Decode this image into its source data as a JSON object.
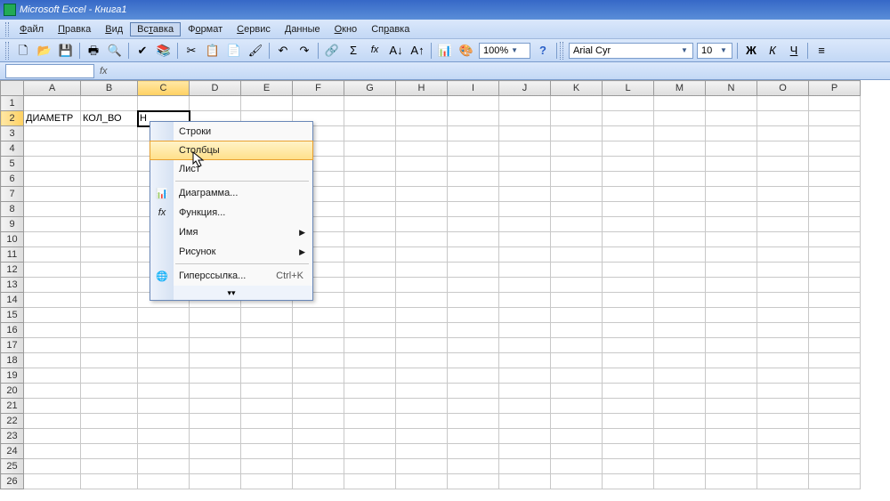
{
  "title": "Microsoft Excel - Книга1",
  "menubar": [
    "Файл",
    "Правка",
    "Вид",
    "Вставка",
    "Формат",
    "Сервис",
    "Данные",
    "Окно",
    "Справка"
  ],
  "menubar_underline_idx": [
    0,
    0,
    0,
    2,
    1,
    0,
    0,
    0,
    2
  ],
  "menu_open_index": 3,
  "dropdown": {
    "items": [
      {
        "label": "Строки",
        "icon": "",
        "submenu": false
      },
      {
        "label": "Столбцы",
        "icon": "",
        "submenu": false,
        "highlight": true
      },
      {
        "label": "Лист",
        "icon": "",
        "submenu": false,
        "sep_after": true
      },
      {
        "label": "Диаграмма...",
        "icon": "📊",
        "submenu": false
      },
      {
        "label": "Функция...",
        "icon": "fx",
        "submenu": false
      },
      {
        "label": "Имя",
        "icon": "",
        "submenu": true
      },
      {
        "label": "Рисунок",
        "icon": "",
        "submenu": true,
        "sep_after": true
      },
      {
        "label": "Гиперссылка...",
        "icon": "🌐",
        "shortcut": "Ctrl+K",
        "submenu": false
      }
    ]
  },
  "toolbar": {
    "zoom": "100%",
    "font": "Arial Cyr",
    "fontsize": "10"
  },
  "grid": {
    "columns": [
      "A",
      "B",
      "C",
      "D",
      "E",
      "F",
      "G",
      "H",
      "I",
      "J",
      "K",
      "L",
      "M",
      "N",
      "O",
      "P"
    ],
    "rows": 26,
    "active_cell": "C2",
    "selected_col": 2,
    "selected_row": 2,
    "cells": {
      "A2": "ДИАМЕТР",
      "B2": "КОЛ_ВО",
      "C2": "Н"
    }
  },
  "formulabar": {
    "namebox": ""
  }
}
